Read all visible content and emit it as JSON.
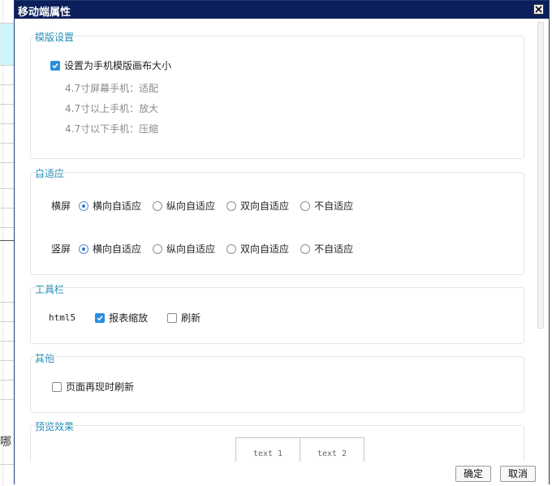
{
  "window": {
    "title": "移动端属性"
  },
  "background": {
    "partial_char": "哪"
  },
  "template": {
    "title": "模版设置",
    "checkbox_label": "设置为手机模版画布大小",
    "checked": true,
    "hints": [
      "4.7寸屏幕手机：适配",
      "4.7寸以上手机：放大",
      "4.7寸以下手机：压缩"
    ]
  },
  "adaptive": {
    "title": "自适应",
    "landscape": {
      "label": "横屏",
      "selected": "横向自适应"
    },
    "portrait": {
      "label": "竖屏",
      "selected": "横向自适应"
    },
    "options": [
      "横向自适应",
      "纵向自适应",
      "双向自适应",
      "不自适应"
    ]
  },
  "toolbar": {
    "title": "工具栏",
    "label": "html5",
    "items": [
      {
        "label": "报表缩放",
        "checked": true
      },
      {
        "label": "刷新",
        "checked": false
      }
    ]
  },
  "other": {
    "title": "其他",
    "items": [
      {
        "label": "页面再现时刷新",
        "checked": false
      }
    ]
  },
  "preview": {
    "title": "预览效果",
    "cells": [
      "text 1",
      "text 2"
    ]
  },
  "footer": {
    "ok": "确定",
    "cancel": "取消"
  },
  "colors": {
    "titlebar": "#0b1f5c",
    "section_title": "#1a8ab6",
    "accent": "#2b8ee0"
  }
}
